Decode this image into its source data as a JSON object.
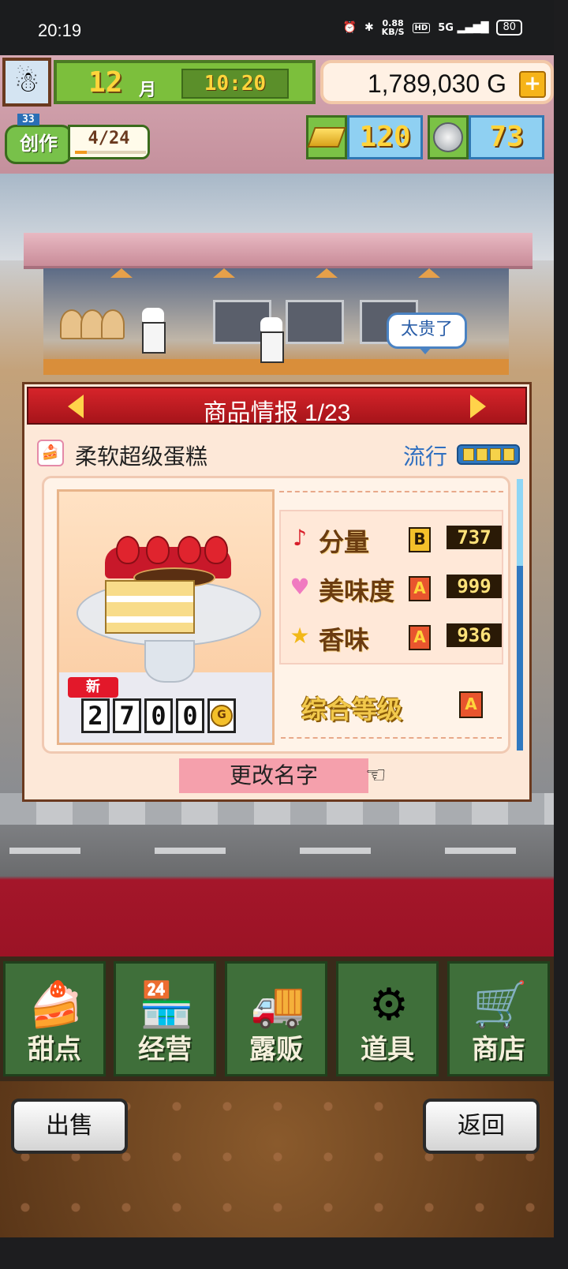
{
  "status_bar": {
    "time": "20:19",
    "net_speed_value": "0.88",
    "net_speed_unit": "KB/S",
    "hd": "HD",
    "signal": "5G",
    "battery": "80",
    "icons": [
      "alarm-icon",
      "bluetooth-icon",
      "signal-icon",
      "battery-icon"
    ]
  },
  "hud": {
    "month": "12",
    "month_label": "月",
    "clock": "10:20",
    "money": "1,789,030 G",
    "add_money_label": "+",
    "craft_level": "33",
    "craft_label": "创作",
    "craft_progress": "4/24",
    "craft_progress_fraction": 0.17,
    "gold_bars": "120",
    "medals": "73"
  },
  "scene": {
    "customer_speech": "太贵了"
  },
  "panel": {
    "title": "商品情报 1/23",
    "item_name": "柔软超级蛋糕",
    "trend_label": "流行",
    "trend_level": 4,
    "new_badge": "新",
    "price_digits": [
      "2",
      "7",
      "0",
      "0"
    ],
    "price_currency": "G",
    "stats": [
      {
        "icon": "music-note-icon",
        "label": "分量",
        "grade": "B",
        "value": "737"
      },
      {
        "icon": "heart-icon",
        "label": "美味度",
        "grade": "A",
        "value": "999"
      },
      {
        "icon": "star-icon",
        "label": "香味",
        "grade": "A",
        "value": "936"
      }
    ],
    "overall_label": "综合等级",
    "overall_grade": "A",
    "rename_button": "更改名字"
  },
  "nav": [
    {
      "label": "甜点",
      "icon": "cake-icon"
    },
    {
      "label": "经营",
      "icon": "shop-icon"
    },
    {
      "label": "露贩",
      "icon": "food-truck-icon"
    },
    {
      "label": "道具",
      "icon": "items-icon"
    },
    {
      "label": "商店",
      "icon": "cart-icon"
    }
  ],
  "footer": {
    "sell_button": "出售",
    "back_button": "返回"
  },
  "colors": {
    "panel_header": "#c41c22",
    "hud_green": "#7cbf3c",
    "nav_green": "#3f6f3a",
    "trend_blue": "#2f6fc0"
  }
}
